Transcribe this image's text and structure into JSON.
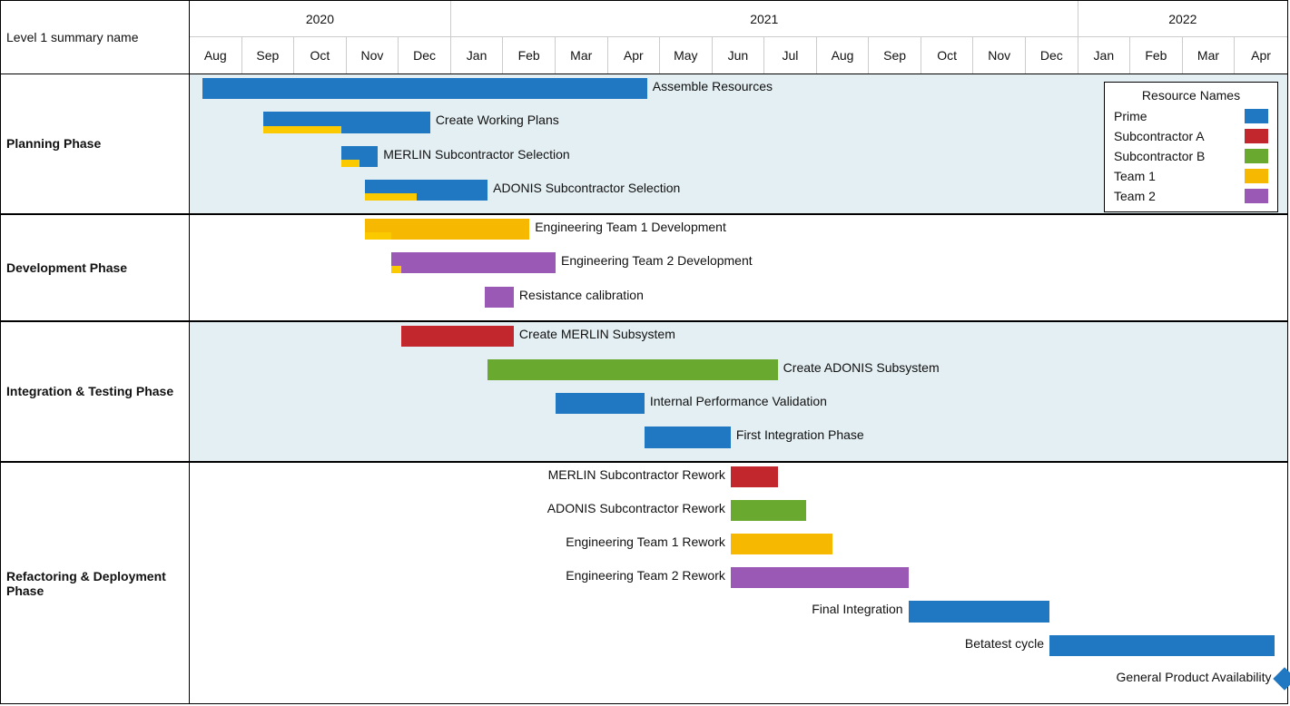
{
  "chart_data": {
    "type": "gantt",
    "title": "",
    "summary_column_label": "Level 1 summary name",
    "months": [
      "Aug",
      "Sep",
      "Oct",
      "Nov",
      "Dec",
      "Jan",
      "Feb",
      "Mar",
      "Apr",
      "May",
      "Jun",
      "Jul",
      "Aug",
      "Sep",
      "Oct",
      "Nov",
      "Dec",
      "Jan",
      "Feb",
      "Mar",
      "Apr"
    ],
    "years": [
      {
        "label": "2020",
        "span_months": 5
      },
      {
        "label": "2021",
        "span_months": 12
      },
      {
        "label": "2022",
        "span_months": 4
      }
    ],
    "resources": [
      {
        "name": "Prime",
        "color": "#1f78c1"
      },
      {
        "name": "Subcontractor A",
        "color": "#c1272d"
      },
      {
        "name": "Subcontractor B",
        "color": "#6aa92f"
      },
      {
        "name": "Team 1",
        "color": "#f6b800"
      },
      {
        "name": "Team 2",
        "color": "#9b59b6"
      }
    ],
    "legend_title": "Resource Names",
    "phases": [
      {
        "name": "Planning Phase",
        "shaded": true,
        "tasks": [
          {
            "label": "Assemble Resources",
            "resource": "Prime",
            "start": 0.25,
            "end": 8.75,
            "overlay_end": null,
            "label_side": "right"
          },
          {
            "label": "Create Working Plans",
            "resource": "Prime",
            "start": 1.4,
            "end": 4.6,
            "overlay_end": 2.9,
            "label_side": "right"
          },
          {
            "label": "MERLIN Subcontractor Selection",
            "resource": "Prime",
            "start": 2.9,
            "end": 3.6,
            "overlay_end": 3.25,
            "label_side": "right"
          },
          {
            "label": "ADONIS Subcontractor Selection",
            "resource": "Prime",
            "start": 3.35,
            "end": 5.7,
            "overlay_end": 4.35,
            "label_side": "right"
          }
        ]
      },
      {
        "name": "Development Phase",
        "shaded": false,
        "tasks": [
          {
            "label": "Engineering Team 1 Development",
            "resource": "Team 1",
            "start": 3.35,
            "end": 6.5,
            "overlay_end": 3.85,
            "label_side": "right"
          },
          {
            "label": "Engineering Team 2 Development",
            "resource": "Team 2",
            "start": 3.85,
            "end": 7.0,
            "overlay_end": 4.05,
            "label_side": "right"
          },
          {
            "label": "Resistance calibration",
            "resource": "Team 2",
            "start": 5.65,
            "end": 6.2,
            "overlay_end": null,
            "label_side": "right"
          }
        ]
      },
      {
        "name": "Integration & Testing Phase",
        "shaded": true,
        "tasks": [
          {
            "label": "Create MERLIN Subsystem",
            "resource": "Subcontractor A",
            "start": 4.05,
            "end": 6.2,
            "overlay_end": null,
            "label_side": "right"
          },
          {
            "label": "Create ADONIS Subsystem",
            "resource": "Subcontractor B",
            "start": 5.7,
            "end": 11.25,
            "overlay_end": null,
            "label_side": "right"
          },
          {
            "label": "Internal Performance Validation",
            "resource": "Prime",
            "start": 7.0,
            "end": 8.7,
            "overlay_end": null,
            "label_side": "right"
          },
          {
            "label": "First Integration Phase",
            "resource": "Prime",
            "start": 8.7,
            "end": 10.35,
            "overlay_end": null,
            "label_side": "right"
          }
        ]
      },
      {
        "name": "Refactoring & Deployment Phase",
        "shaded": false,
        "tasks": [
          {
            "label": "MERLIN Subcontractor Rework",
            "resource": "Subcontractor A",
            "start": 10.35,
            "end": 11.25,
            "overlay_end": null,
            "label_side": "left"
          },
          {
            "label": "ADONIS Subcontractor Rework",
            "resource": "Subcontractor B",
            "start": 10.35,
            "end": 11.8,
            "overlay_end": null,
            "label_side": "left"
          },
          {
            "label": "Engineering Team 1 Rework",
            "resource": "Team 1",
            "start": 10.35,
            "end": 12.3,
            "overlay_end": null,
            "label_side": "left"
          },
          {
            "label": "Engineering Team 2 Rework",
            "resource": "Team 2",
            "start": 10.35,
            "end": 13.75,
            "overlay_end": null,
            "label_side": "left"
          },
          {
            "label": "Final Integration",
            "resource": "Prime",
            "start": 13.75,
            "end": 16.45,
            "overlay_end": null,
            "label_side": "left"
          },
          {
            "label": "Betatest cycle",
            "resource": "Prime",
            "start": 16.45,
            "end": 20.75,
            "overlay_end": null,
            "label_side": "left"
          },
          {
            "label": "General Product Availability",
            "milestone": true,
            "resource": "Prime",
            "at": 20.8,
            "label_side": "left"
          }
        ]
      }
    ]
  }
}
